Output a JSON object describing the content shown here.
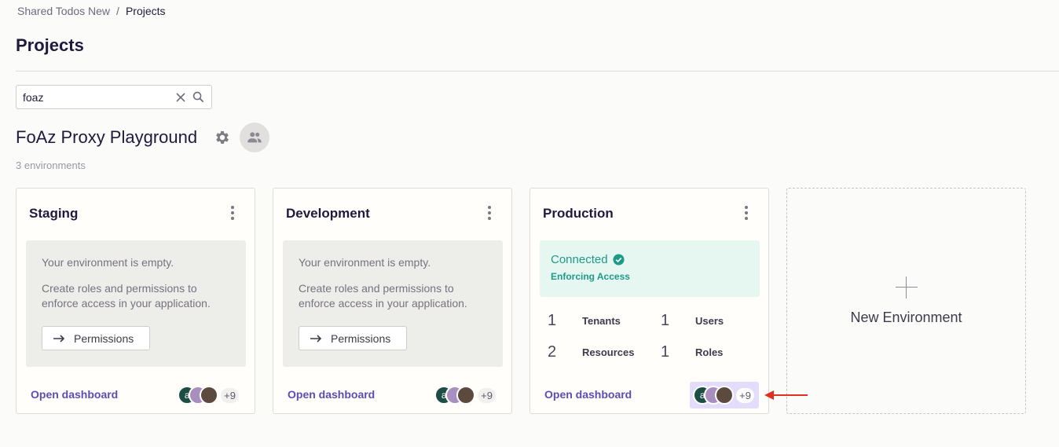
{
  "breadcrumb": {
    "parent": "Shared Todos New",
    "separator": "/",
    "current": "Projects"
  },
  "page_title": "Projects",
  "search": {
    "value": "foaz",
    "clear_icon": "close-icon",
    "search_icon": "search-icon"
  },
  "project": {
    "name": "FoAz Proxy Playground",
    "env_count": "3 environments"
  },
  "environments": [
    {
      "title": "Staging",
      "empty_line1": "Your environment is empty.",
      "empty_line2": "Create roles and permissions to enforce access in your application.",
      "permissions_label": "Permissions",
      "open_dashboard": "Open dashboard",
      "avatar_initial": "a",
      "avatar_more": "+9"
    },
    {
      "title": "Development",
      "empty_line1": "Your environment is empty.",
      "empty_line2": "Create roles and permissions to enforce access in your application.",
      "permissions_label": "Permissions",
      "open_dashboard": "Open dashboard",
      "avatar_initial": "a",
      "avatar_more": "+9"
    },
    {
      "title": "Production",
      "status": "Connected",
      "status_sub": "Enforcing Access",
      "stats": [
        {
          "num": "1",
          "label": "Tenants"
        },
        {
          "num": "1",
          "label": "Users"
        },
        {
          "num": "2",
          "label": "Resources"
        },
        {
          "num": "1",
          "label": "Roles"
        }
      ],
      "open_dashboard": "Open dashboard",
      "avatar_initial": "a",
      "avatar_more": "+9"
    }
  ],
  "new_environment": "New Environment",
  "colors": {
    "accent": "#5f4bb6",
    "success": "#1f9a86",
    "arrow": "#e0301e"
  }
}
